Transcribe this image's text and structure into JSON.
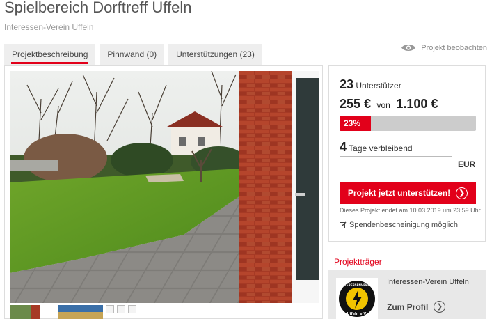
{
  "page": {
    "title": "Spielbereich Dorftreff Uffeln",
    "subtitle": "Interessen-Verein Uffeln"
  },
  "tabs": [
    {
      "label": "Projektbeschreibung",
      "active": true
    },
    {
      "label": "Pinnwand (0)",
      "active": false
    },
    {
      "label": "Unterstützungen (23)",
      "active": false
    }
  ],
  "watch": {
    "label": "Projekt beobachten",
    "icon": "eye-icon"
  },
  "support": {
    "supporters_count": "23",
    "supporters_label": "Unterstützer",
    "raised": "255 €",
    "von": "von",
    "goal": "1.100 €",
    "progress_label": "23%",
    "progress_fraction": 0.23,
    "days_count": "4",
    "days_label": "Tage verbleibend",
    "input_value": "",
    "currency": "EUR",
    "cta_label": "Projekt jetzt unterstützen!",
    "ends_text": "Dieses Projekt endet am 10.03.2019 um 23:59 Uhr.",
    "donation_text": "Spendenbescheinigung möglich"
  },
  "traeger": {
    "section_title": "Projektträger",
    "name": "Interessen-Verein Uffeln",
    "profile_label": "Zum Profil",
    "logo_text_top": "INTERESSENVEREIN",
    "logo_text_bottom": "Uffeln e.V."
  },
  "colors": {
    "accent": "#e2001a",
    "tab_bg": "#eeeeee",
    "progress_track": "#cccccc"
  }
}
